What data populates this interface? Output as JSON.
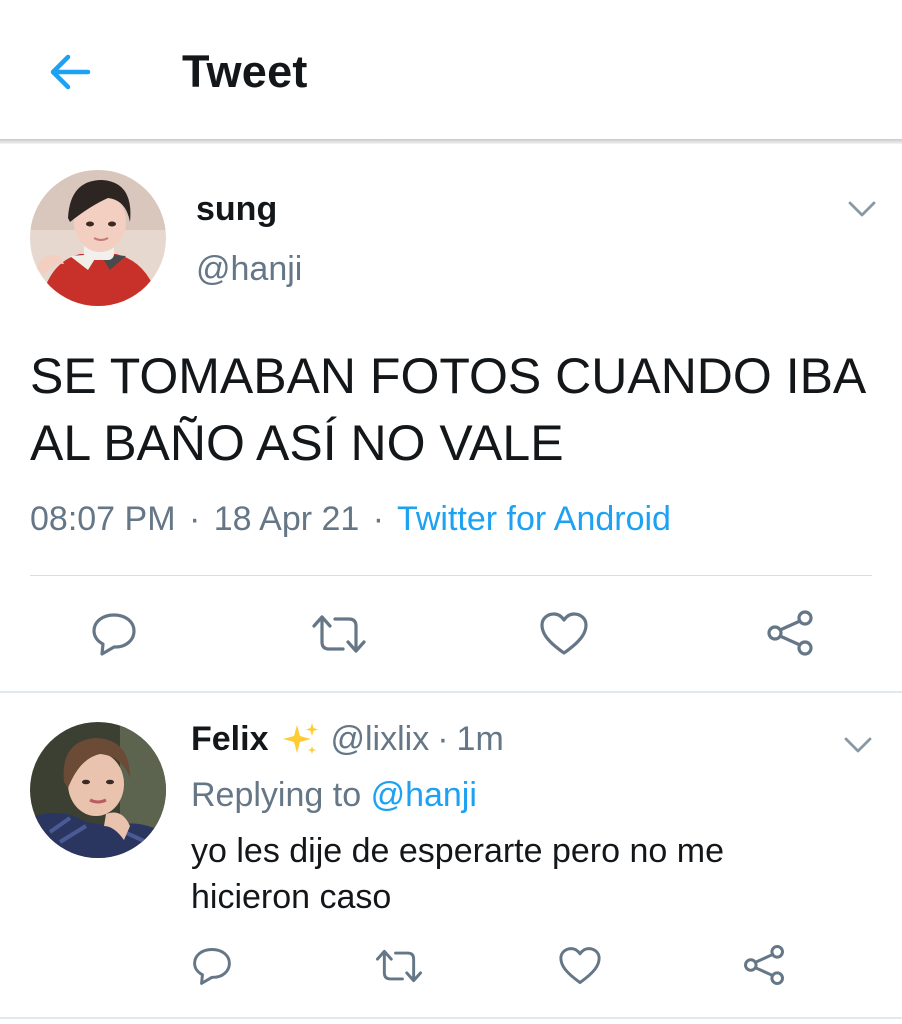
{
  "header": {
    "title": "Tweet",
    "back_icon": "arrow-left-icon",
    "accent_color": "#1da1f2"
  },
  "main_tweet": {
    "display_name": "sung",
    "handle": "@hanji",
    "text": "SE TOMABAN FOTOS CUANDO IBA AL BAÑO ASÍ NO VALE",
    "time": "08:07 PM",
    "separator": "·",
    "date": "18 Apr 21",
    "source": "Twitter for Android",
    "actions": [
      "reply-icon",
      "retweet-icon",
      "like-icon",
      "share-icon"
    ]
  },
  "reply_tweet": {
    "display_name": "Felix",
    "badge_icon": "sparkles-icon",
    "handle": "@lixlix",
    "separator": "·",
    "time": "1m",
    "replying_prefix": "Replying to",
    "replying_to": "@hanji",
    "text": "yo les dije de esperarte pero no me hicieron caso",
    "actions": [
      "reply-icon",
      "retweet-icon",
      "like-icon",
      "share-icon"
    ]
  },
  "colors": {
    "text_primary": "#14171a",
    "text_secondary": "#657786",
    "link": "#1da1f2",
    "divider": "#e1e8ed",
    "icon": "#657786"
  }
}
